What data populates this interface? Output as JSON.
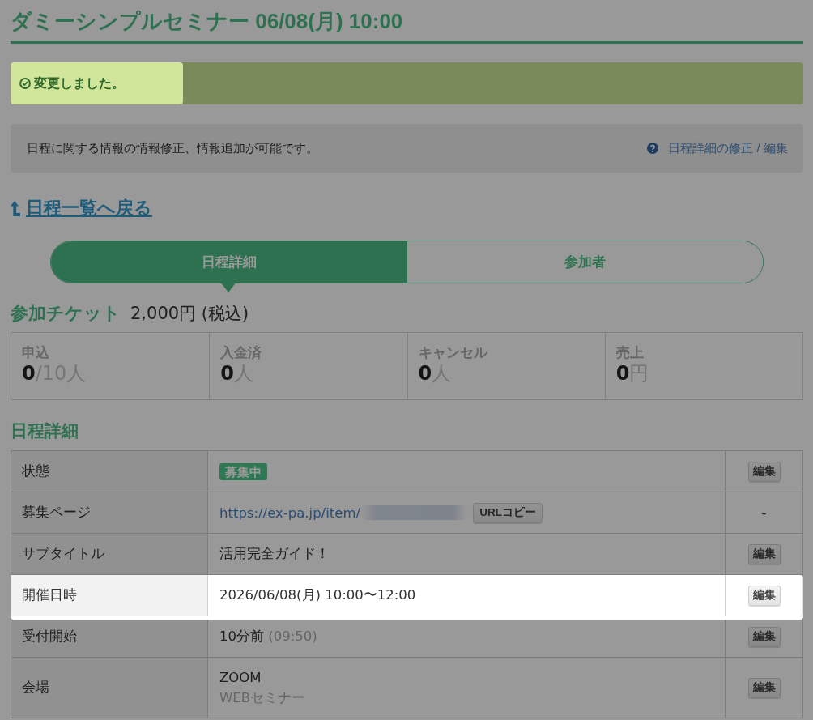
{
  "title": "ダミーシンプルセミナー 06/08(月) 10:00",
  "alert": {
    "text": "変更しました。"
  },
  "info": {
    "text": "日程に関する情報の情報修正、情報追加が可能です。",
    "help_link": "日程詳細の修正 / 編集"
  },
  "back_link": "日程一覧へ戻る",
  "tabs": [
    {
      "label": "日程詳細",
      "selected": true
    },
    {
      "label": "参加者",
      "selected": false
    }
  ],
  "ticket": {
    "heading": "参加チケット",
    "price": "2,000円 (税込)"
  },
  "stats": [
    {
      "label": "申込",
      "value": "0",
      "unit": "/10人"
    },
    {
      "label": "入金済",
      "value": "0",
      "unit": "人"
    },
    {
      "label": "キャンセル",
      "value": "0",
      "unit": "人"
    },
    {
      "label": "売上",
      "value": "0",
      "unit": "円"
    }
  ],
  "details": {
    "heading": "日程詳細",
    "rows": [
      {
        "label": "状態",
        "kind": "badge",
        "value": "募集中",
        "action": {
          "kind": "button",
          "label": "編集"
        },
        "highlighted": false
      },
      {
        "label": "募集ページ",
        "kind": "link",
        "value": "https://ex-pa.jp/item/",
        "button": "URLコピー",
        "action": {
          "kind": "text",
          "label": "-"
        },
        "highlighted": false
      },
      {
        "label": "サブタイトル",
        "kind": "text",
        "value": "活用完全ガイド！",
        "action": {
          "kind": "button",
          "label": "編集"
        },
        "highlighted": false
      },
      {
        "label": "開催日時",
        "kind": "text",
        "value": "2026/06/08(月) 10:00〜12:00",
        "action": {
          "kind": "button",
          "label": "編集"
        },
        "highlighted": true
      },
      {
        "label": "受付開始",
        "kind": "text",
        "value": "10分前",
        "note": "(09:50)",
        "action": {
          "kind": "button",
          "label": "編集"
        },
        "highlighted": false
      },
      {
        "label": "会場",
        "kind": "text",
        "value": "ZOOM",
        "sub": "WEBセミナー",
        "action": {
          "kind": "button",
          "label": "編集"
        },
        "highlighted": false
      }
    ]
  }
}
